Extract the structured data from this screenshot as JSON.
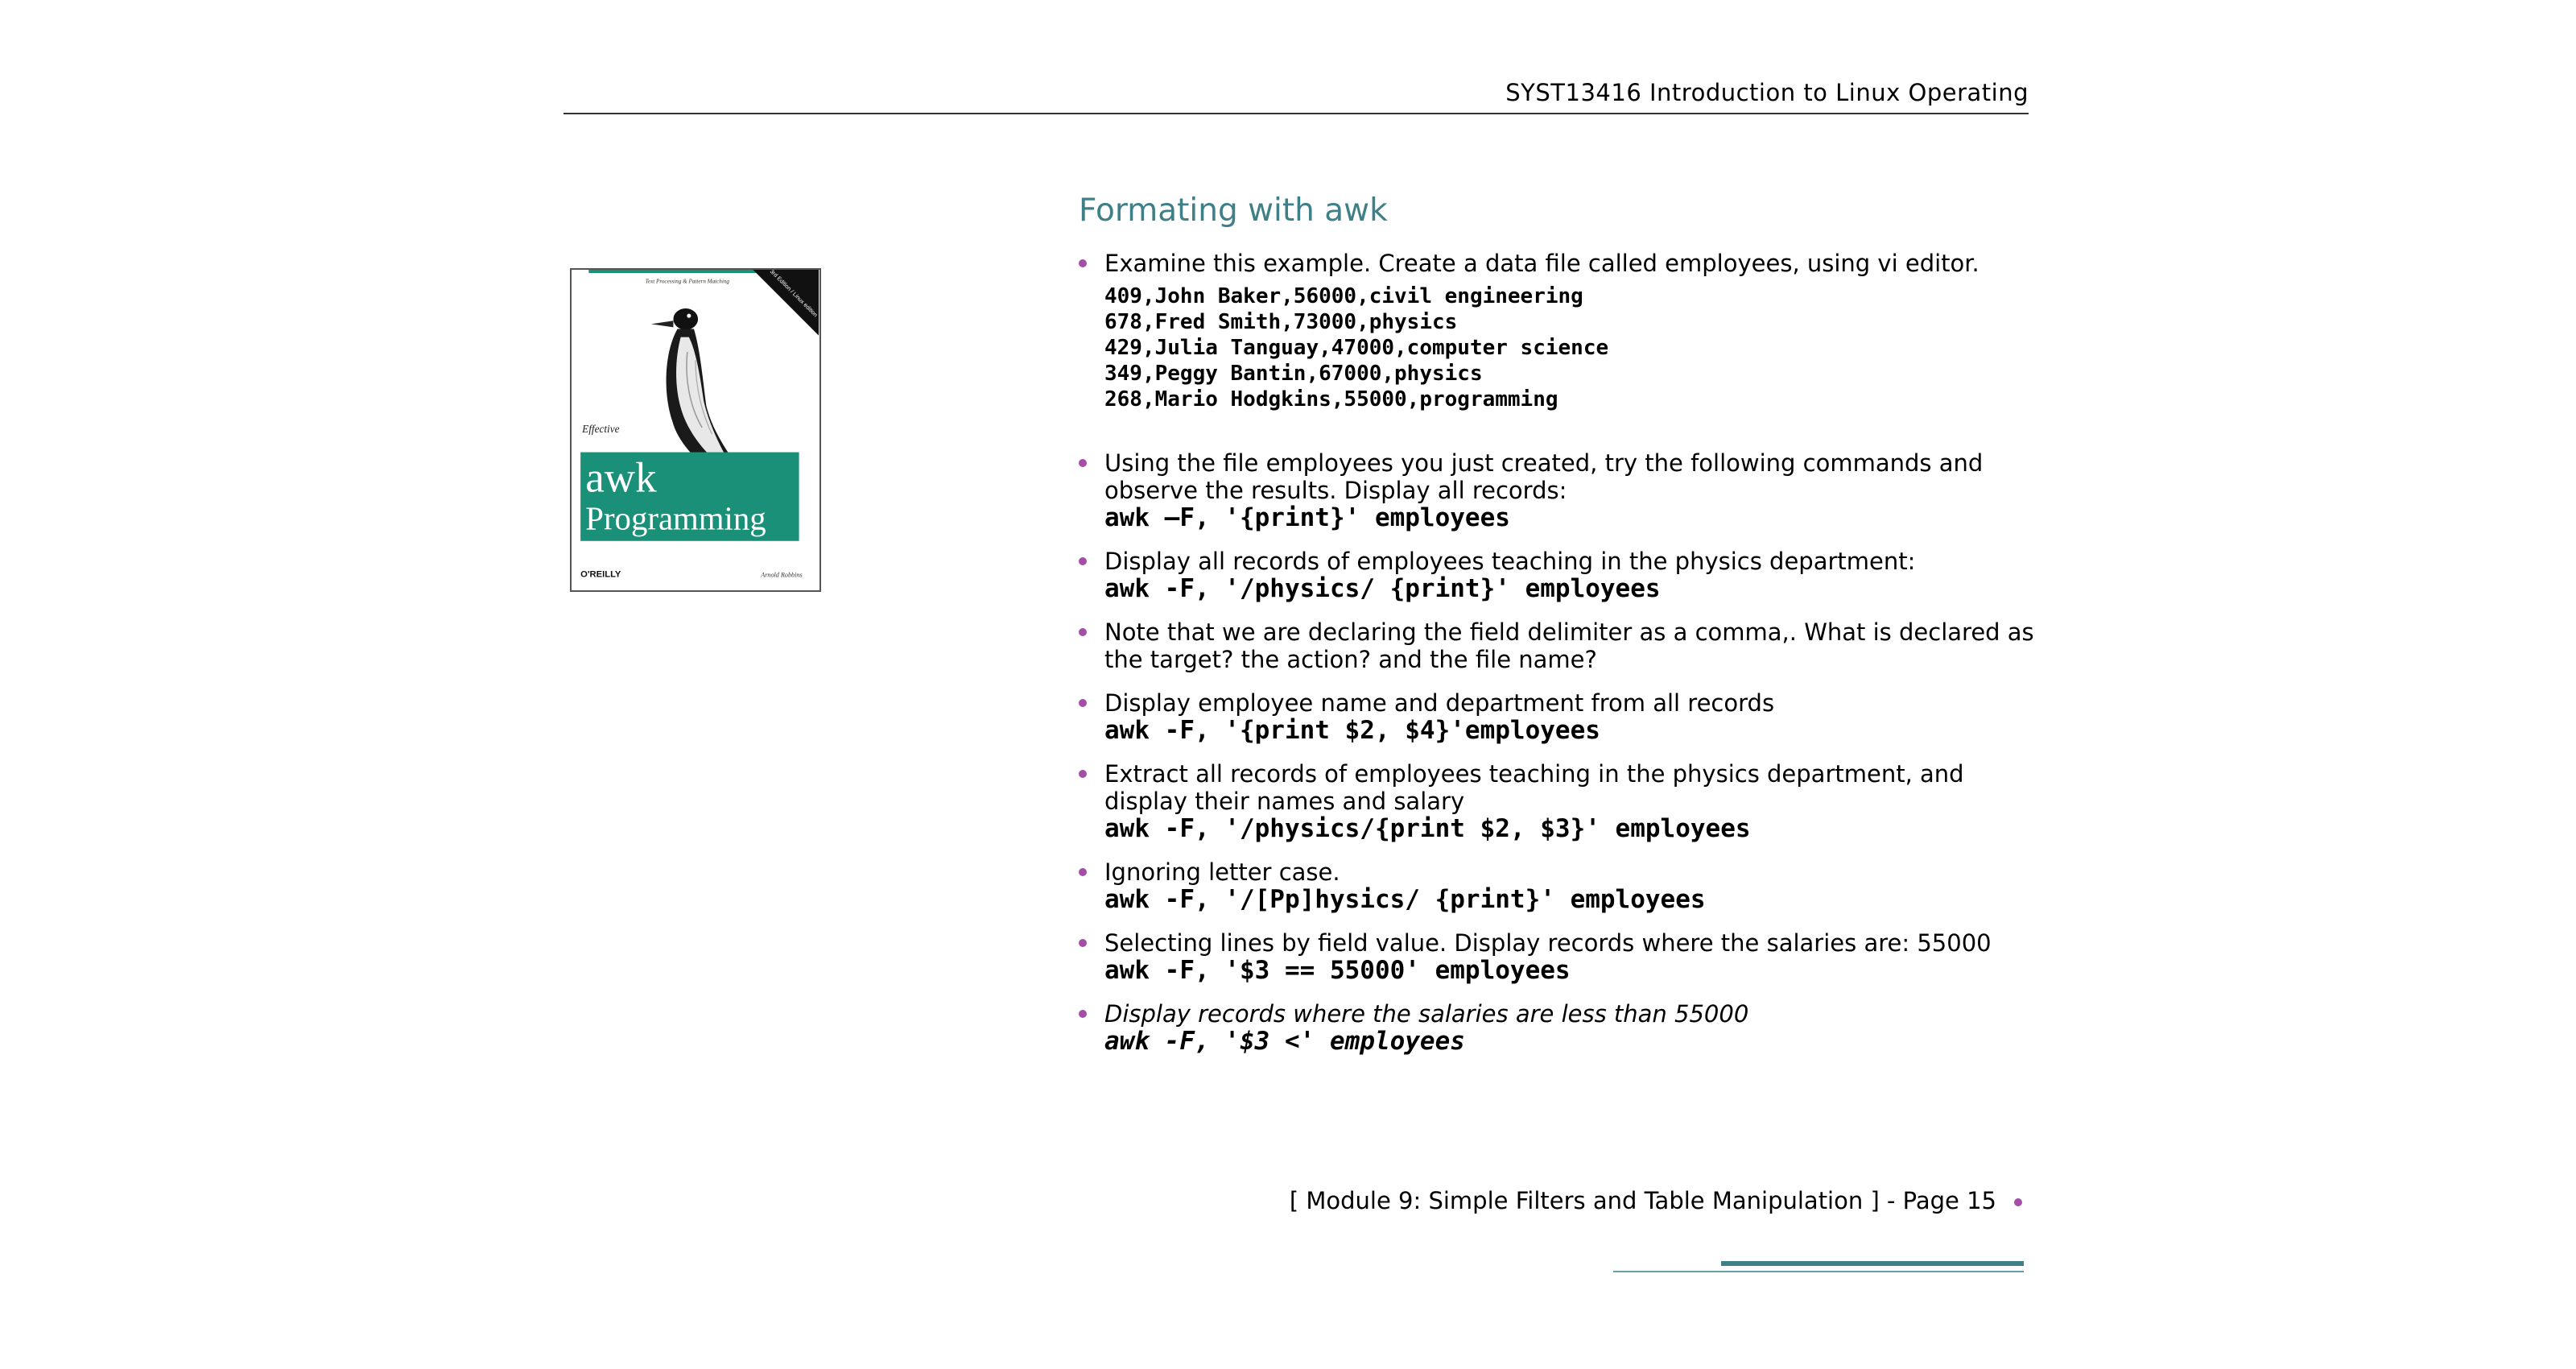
{
  "header": {
    "title": "SYST13416 Introduction to Linux Operating"
  },
  "book_cover": {
    "tagline": "Text Processing & Pattern Matching",
    "edition_banner": "3rd Edition / Linux edition",
    "prefix": "Effective",
    "title_line1": "awk",
    "title_line2": "Programming",
    "publisher": "O'REILLY",
    "author": "Arnold Robbins",
    "accent_color": "#1a9078"
  },
  "main": {
    "section_title": "Formating with awk",
    "items": [
      {
        "text": "Examine this example. Create a data file called employees, using vi editor.",
        "data_lines": [
          "409,John Baker,56000,civil engineering",
          "678,Fred Smith,73000,physics",
          "429,Julia Tanguay,47000,computer science",
          "349,Peggy Bantin,67000,physics",
          "268,Mario Hodgkins,55000,programming"
        ]
      },
      {
        "text": "Using the file employees  you just created, try the following commands and observe the results. Display  all records:",
        "code": "awk –F, '{print}' employees"
      },
      {
        "text": "Display all records of employees teaching in the physics department:",
        "code": "awk -F, '/physics/ {print}' employees"
      },
      {
        "text": "Note that we are declaring the field delimiter as a comma,. What is declared as the target?  the action?  and the file name?"
      },
      {
        "text": "Display employee name and department from all records",
        "code": "awk -F, '{print $2, $4}'employees"
      },
      {
        "text": "Extract all records of employees teaching in the physics department, and display their names and salary",
        "code": "awk -F, '/physics/{print $2, $3}' employees"
      },
      {
        "text": "Ignoring letter case.",
        "code": "awk -F, '/[Pp]hysics/ {print}' employees"
      },
      {
        "text": "Selecting lines by field value. Display records where the salaries are: 55000",
        "code": "awk -F, '$3 == 55000' employees"
      },
      {
        "text": "Display records where the salaries are less than 55000",
        "code": "awk -F, '$3 <' employees",
        "italic": true
      }
    ]
  },
  "footer": {
    "text": "[ Module 9:  Simple Filters and Table Manipulation ] - Page 15"
  },
  "colors": {
    "accent_teal": "#3f7f88",
    "bullet_purple": "#a44ea8"
  }
}
